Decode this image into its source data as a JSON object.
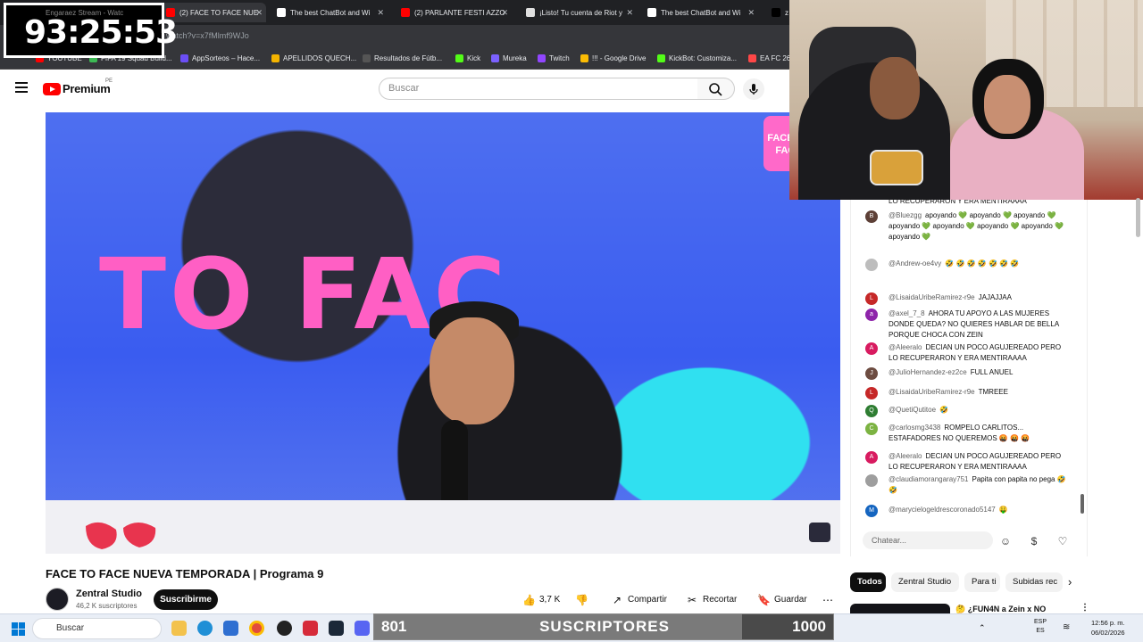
{
  "timer": {
    "small": "Engaraez Stream - Watc",
    "value": "93:25:53"
  },
  "tabs": [
    {
      "label": "Engaraez Stream - Watc",
      "color": "#2e7d32"
    },
    {
      "label": "(2) FACE TO FACE NUE",
      "color": "#ff0000"
    },
    {
      "label": "The best ChatBot and Wi",
      "color": "#ffffff"
    },
    {
      "label": "(2) PARLANTE FESTI AZZO",
      "color": "#ff0000"
    },
    {
      "label": "¡Listo! Tu cuenta de Riot y",
      "color": "#e0e0e0"
    },
    {
      "label": "The best ChatBot and Wi",
      "color": "#ffffff"
    },
    {
      "label": "z",
      "color": "#000000"
    }
  ],
  "url": "watch?v=x7fMlmf9WJo",
  "bookmarks": [
    {
      "label": "YOUTUBE",
      "color": "#ff0000"
    },
    {
      "label": "FIFA 19 Squad Build...",
      "color": "#3cba54"
    },
    {
      "label": "AppSorteos – Hace...",
      "color": "#6b4ef5"
    },
    {
      "label": "APELLIDOS QUECH...",
      "color": "#f4b400"
    },
    {
      "label": "Resultados de Fútb...",
      "color": "#555555"
    },
    {
      "label": "Kick",
      "color": "#53fc18"
    },
    {
      "label": "Mureka",
      "color": "#7b61ff"
    },
    {
      "label": "Twitch",
      "color": "#9146ff"
    },
    {
      "label": "!!! - Google Drive",
      "color": "#fbbc04"
    },
    {
      "label": "KickBot: Customiza...",
      "color": "#53fc18"
    },
    {
      "label": "EA FC 26",
      "color": "#ff4747"
    }
  ],
  "youtube": {
    "brand": "Premium",
    "region": "PE",
    "search_placeholder": "Buscar"
  },
  "video": {
    "overlay_text": "TO FAC",
    "corner_logo": "FACE TO FACE",
    "title": "FACE TO FACE NUEVA TEMPORADA | Programa 9",
    "channel": "Zentral Studio",
    "subscribers": "46,2 K suscriptores",
    "subscribe_label": "Suscribirme",
    "likes": "3,7 K",
    "share": "Compartir",
    "clip": "Recortar",
    "save": "Guardar"
  },
  "chat": {
    "messages": [
      {
        "author": "",
        "text": "LO RECUPERARON Y ERA MENTIRAAAA",
        "initial": "",
        "color": "#ffffff"
      },
      {
        "author": "@Bluezgg",
        "text": "apoyando 💚 apoyando 💚 apoyando 💚 apoyando 💚 apoyando 💚 apoyando 💚 apoyando 💚 apoyando 💚",
        "initial": "B",
        "color": "#5d4037"
      },
      {
        "author": "@Andrew-oe4vy",
        "text": "🤣 🤣 🤣 🤣 🤣 🤣 🤣",
        "initial": "",
        "color": "#bdbdbd"
      },
      {
        "author": "@LisaidaUribeRamirez-r9e",
        "text": "JAJAJJAA",
        "initial": "L",
        "color": "#c62828"
      },
      {
        "author": "@axel_7_8",
        "text": "AHORA TU APOYO A LAS MUJERES DONDE QUEDA? NO QUIERES HABLAR DE BELLA PORQUE CHOCA CON ZEIN",
        "initial": "a",
        "color": "#8e24aa"
      },
      {
        "author": "@Aleeralo",
        "text": "DECIAN UN POCO AGUJEREADO PERO LO RECUPERARON Y ERA MENTIRAAAA",
        "initial": "A",
        "color": "#d81b60"
      },
      {
        "author": "@JulioHernandez-ez2ce",
        "text": "FULL ANUEL",
        "initial": "J",
        "color": "#6d4c41"
      },
      {
        "author": "@LisaidaUribeRamirez-r9e",
        "text": "TMREEE",
        "initial": "L",
        "color": "#c62828"
      },
      {
        "author": "@QuetiQutitoe",
        "text": "🤣",
        "initial": "Q",
        "color": "#2e7d32"
      },
      {
        "author": "@carlosmg3438",
        "text": "ROMPELO CARLITOS... ESTAFADORES NO QUEREMOS 🤬 🤬 🤬",
        "initial": "C",
        "color": "#7cb342"
      },
      {
        "author": "@Aleeralo",
        "text": "DECIAN UN POCO AGUJEREADO PERO LO RECUPERARON Y ERA MENTIRAAAA",
        "initial": "A",
        "color": "#d81b60"
      },
      {
        "author": "@claudiamorangaray751",
        "text": "Papita con papita no pega 🤣 🤣",
        "initial": "",
        "color": "#9e9e9e"
      },
      {
        "author": "@marycielogeldrescoronado5147",
        "text": "🤑",
        "initial": "M",
        "color": "#1565c0"
      }
    ],
    "input_placeholder": "Chatear..."
  },
  "chips": [
    "Todos",
    "Zentral Studio",
    "Para ti",
    "Subidas rec"
  ],
  "recommendation": {
    "title": "🤔 ¿FUN4N a Zein x NO"
  },
  "subgoal": {
    "current": "801",
    "label": "SUSCRIPTORES",
    "goal": "1000",
    "fraction": 0.801
  },
  "taskbar": {
    "search": "Buscar",
    "lang1": "ESP",
    "lang2": "ES",
    "time": "12:56 p. m.",
    "date": "06/02/2026"
  }
}
